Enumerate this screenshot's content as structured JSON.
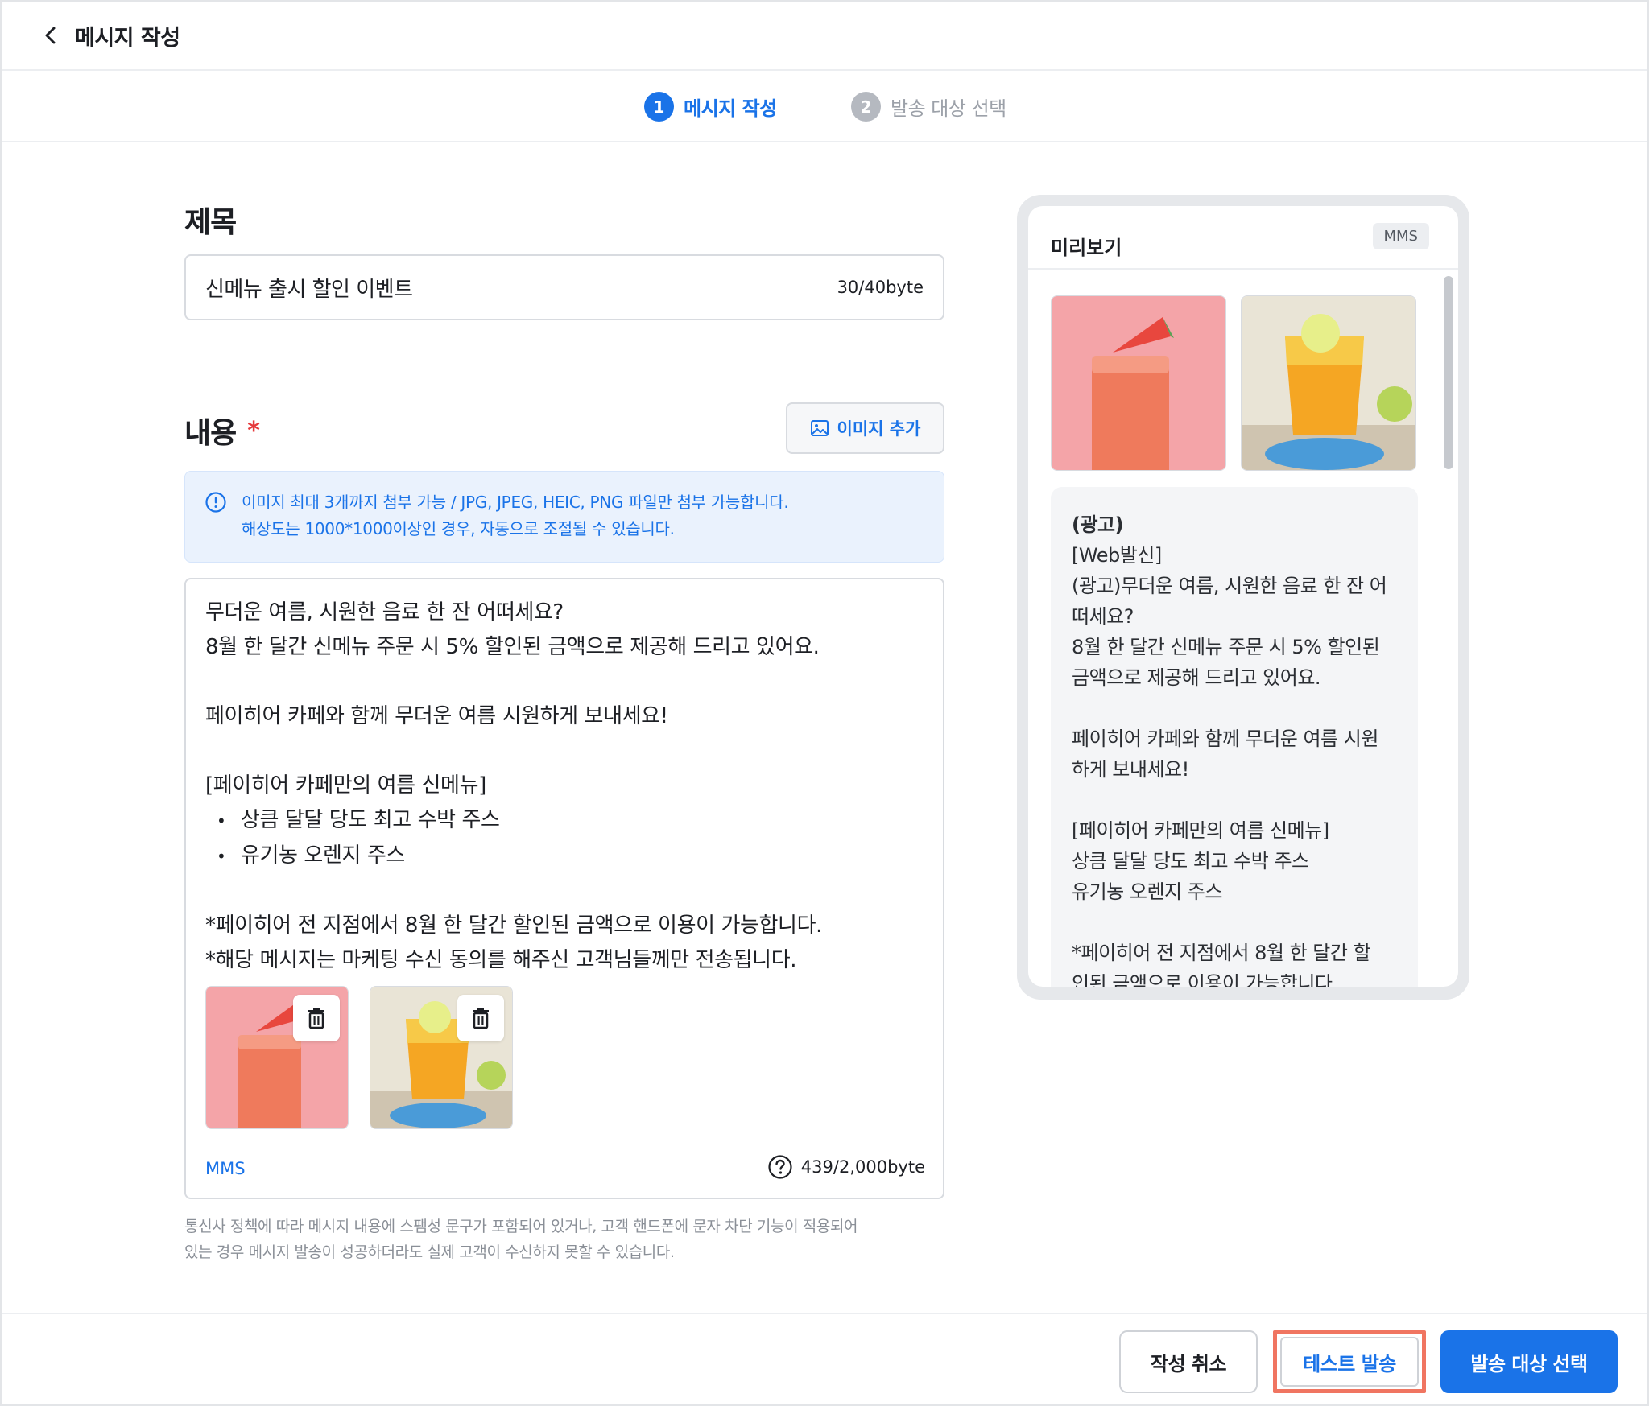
{
  "header": {
    "title": "메시지 작성"
  },
  "stepper": {
    "steps": [
      {
        "num": "1",
        "label": "메시지 작성"
      },
      {
        "num": "2",
        "label": "발송 대상 선택"
      }
    ]
  },
  "title_section": {
    "label": "제목",
    "value": "신메뉴 출시 할인 이벤트",
    "count": "30/40byte"
  },
  "content_section": {
    "label": "내용",
    "required_mark": "*",
    "add_image_label": "이미지 추가",
    "info_line1": "이미지 최대 3개까지 첨부 가능 / JPG, JPEG, HEIC, PNG 파일만 첨부 가능합니다.",
    "info_line2": "해상도는 1000*1000이상인 경우, 자동으로 조절될 수 있습니다.",
    "lines": [
      "무더운 여름, 시원한 음료 한 잔 어떠세요?",
      "8월 한 달간 신메뉴 주문 시 5% 할인된 금액으로 제공해 드리고 있어요.",
      "페이히어 카페와 함께 무더운 여름 시원하게 보내세요!",
      "[페이히어 카페만의 여름 신메뉴]",
      "상큼 달달 당도 최고 수박 주스",
      "유기농 오렌지 주스",
      "*페이히어 전 지점에서 8월 한 달간 할인된 금액으로 이용이 가능합니다.",
      "*해당 메시지는 마케팅 수신 동의를 해주신 고객님들께만 전송됩니다."
    ],
    "type_label": "MMS",
    "byte_count": "439/2,000byte"
  },
  "notice": {
    "line1": "통신사 정책에 따라 메시지 내용에 스팸성 문구가 포함되어 있거나, 고객 핸드폰에 문자 차단 기능이 적용되어",
    "line2": "있는 경우 메시지 발송이 성공하더라도 실제 고객이 수신하지 못할 수 있습니다."
  },
  "preview": {
    "title": "미리보기",
    "badge": "MMS",
    "lines": [
      "(광고)",
      "[Web발신]",
      "(광고)무더운 여름, 시원한 음료 한 잔 어",
      "떠세요?",
      "8월 한 달간 신메뉴 주문 시 5% 할인된",
      "금액으로 제공해 드리고 있어요.",
      "페이히어 카페와 함께 무더운 여름 시원",
      "하게 보내세요!",
      "[페이히어 카페만의 여름 신메뉴]",
      "상큼 달달 당도 최고 수박 주스",
      "유기농 오렌지 주스",
      "*페이히어 전 지점에서 8월 한 달간 할",
      "인된 금액으로 이용이 가능합니다."
    ]
  },
  "footer": {
    "cancel_label": "작성 취소",
    "test_label": "테스트 발송",
    "next_label": "발송 대상 선택"
  },
  "colors": {
    "accent": "#1a73e8",
    "highlight": "#f07561",
    "required": "#e5393b"
  }
}
